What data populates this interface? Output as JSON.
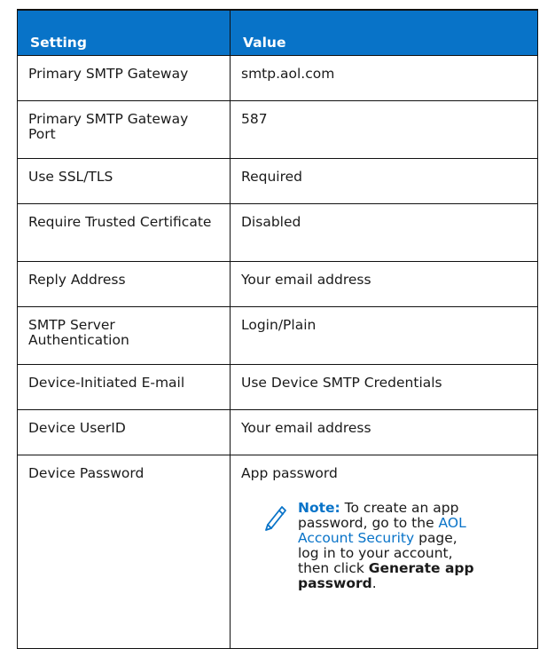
{
  "table": {
    "headers": [
      "Setting",
      "Value"
    ],
    "rows": [
      {
        "setting": "Primary SMTP Gateway",
        "value": "smtp.aol.com"
      },
      {
        "setting": "Primary SMTP Gateway Port",
        "value": "587"
      },
      {
        "setting": "Use SSL/TLS",
        "value": "Required"
      },
      {
        "setting": "Require Trusted Certificate",
        "value": "Disabled"
      },
      {
        "setting": "Reply Address",
        "value": "Your email address"
      },
      {
        "setting": "SMTP Server Authentication",
        "value": "Login/Plain"
      },
      {
        "setting": "Device-Initiated E-mail",
        "value": "Use Device SMTP Credentials"
      },
      {
        "setting": "Device UserID",
        "value": "Your email address"
      },
      {
        "setting": "Device Password",
        "value": "App password"
      }
    ]
  },
  "note": {
    "icon": "pencil-icon",
    "label": "Note:",
    "text_1": " To create an app password, go to the ",
    "link_text": "AOL Account Security",
    "text_2": " page, log in to your account, then click ",
    "bold_text": "Generate app password",
    "text_3": "."
  },
  "colors": {
    "header_bg": "#0873c8",
    "header_text": "#ffffff",
    "accent": "#0873c8",
    "border": "#111111"
  }
}
